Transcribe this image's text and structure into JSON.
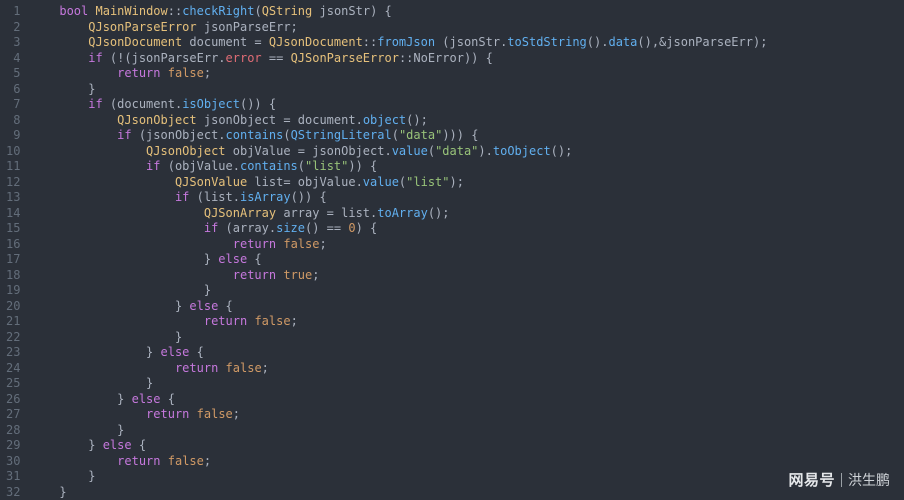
{
  "editor": {
    "line_count": 32,
    "language": "cpp"
  },
  "watermark": {
    "brand": "网易号",
    "author": "洪生鹏"
  },
  "chart_data": null,
  "code": {
    "lines": [
      {
        "tokens": [
          [
            "plain",
            "    "
          ],
          [
            "kw",
            "bool"
          ],
          [
            "plain",
            " "
          ],
          [
            "cls",
            "MainWindow"
          ],
          [
            "plain",
            "::"
          ],
          [
            "fn",
            "checkRight"
          ],
          [
            "plain",
            "("
          ],
          [
            "cls",
            "QString"
          ],
          [
            "plain",
            " jsonStr) {"
          ]
        ]
      },
      {
        "tokens": [
          [
            "plain",
            "        "
          ],
          [
            "cls",
            "QJsonParseError"
          ],
          [
            "plain",
            " jsonParseErr;"
          ]
        ]
      },
      {
        "tokens": [
          [
            "plain",
            "        "
          ],
          [
            "cls",
            "QJsonDocument"
          ],
          [
            "plain",
            " document = "
          ],
          [
            "cls",
            "QJsonDocument"
          ],
          [
            "plain",
            "::"
          ],
          [
            "fn",
            "fromJson"
          ],
          [
            "plain",
            " (jsonStr."
          ],
          [
            "fn",
            "toStdString"
          ],
          [
            "plain",
            "()."
          ],
          [
            "fn",
            "data"
          ],
          [
            "plain",
            "(),&jsonParseErr);"
          ]
        ]
      },
      {
        "tokens": [
          [
            "plain",
            "        "
          ],
          [
            "kw",
            "if"
          ],
          [
            "plain",
            " (!(jsonParseErr."
          ],
          [
            "id",
            "error"
          ],
          [
            "plain",
            " == "
          ],
          [
            "cls",
            "QJSonParseError"
          ],
          [
            "plain",
            "::NoError)) {"
          ]
        ]
      },
      {
        "tokens": [
          [
            "plain",
            "            "
          ],
          [
            "kw",
            "return"
          ],
          [
            "plain",
            " "
          ],
          [
            "lit",
            "false"
          ],
          [
            "plain",
            ";"
          ]
        ]
      },
      {
        "tokens": [
          [
            "plain",
            "        }"
          ]
        ]
      },
      {
        "tokens": [
          [
            "plain",
            "        "
          ],
          [
            "kw",
            "if"
          ],
          [
            "plain",
            " (document."
          ],
          [
            "fn",
            "isObject"
          ],
          [
            "plain",
            "()) {"
          ]
        ]
      },
      {
        "tokens": [
          [
            "plain",
            "            "
          ],
          [
            "cls",
            "QJsonObject"
          ],
          [
            "plain",
            " jsonObject = document."
          ],
          [
            "fn",
            "object"
          ],
          [
            "plain",
            "();"
          ]
        ]
      },
      {
        "tokens": [
          [
            "plain",
            "            "
          ],
          [
            "kw",
            "if"
          ],
          [
            "plain",
            " (jsonObject."
          ],
          [
            "fn",
            "contains"
          ],
          [
            "plain",
            "("
          ],
          [
            "fn",
            "QStringLiteral"
          ],
          [
            "plain",
            "("
          ],
          [
            "str",
            "\"data\""
          ],
          [
            "plain",
            "))) {"
          ]
        ]
      },
      {
        "tokens": [
          [
            "plain",
            "                "
          ],
          [
            "cls",
            "QJsonObject"
          ],
          [
            "plain",
            " objValue = jsonObject."
          ],
          [
            "fn",
            "value"
          ],
          [
            "plain",
            "("
          ],
          [
            "str",
            "\"data\""
          ],
          [
            "plain",
            ")."
          ],
          [
            "fn",
            "toObject"
          ],
          [
            "plain",
            "();"
          ]
        ]
      },
      {
        "tokens": [
          [
            "plain",
            "                "
          ],
          [
            "kw",
            "if"
          ],
          [
            "plain",
            " (objValue."
          ],
          [
            "fn",
            "contains"
          ],
          [
            "plain",
            "("
          ],
          [
            "str",
            "\"list\""
          ],
          [
            "plain",
            ")) {"
          ]
        ]
      },
      {
        "tokens": [
          [
            "plain",
            "                    "
          ],
          [
            "cls",
            "QJSonValue"
          ],
          [
            "plain",
            " list= objValue."
          ],
          [
            "fn",
            "value"
          ],
          [
            "plain",
            "("
          ],
          [
            "str",
            "\"list\""
          ],
          [
            "plain",
            ");"
          ]
        ]
      },
      {
        "tokens": [
          [
            "plain",
            "                    "
          ],
          [
            "kw",
            "if"
          ],
          [
            "plain",
            " (list."
          ],
          [
            "fn",
            "isArray"
          ],
          [
            "plain",
            "()) {"
          ]
        ]
      },
      {
        "tokens": [
          [
            "plain",
            "                        "
          ],
          [
            "cls",
            "QJSonArray"
          ],
          [
            "plain",
            " array = list."
          ],
          [
            "fn",
            "toArray"
          ],
          [
            "plain",
            "();"
          ]
        ]
      },
      {
        "tokens": [
          [
            "plain",
            "                        "
          ],
          [
            "kw",
            "if"
          ],
          [
            "plain",
            " (array."
          ],
          [
            "fn",
            "size"
          ],
          [
            "plain",
            "() == "
          ],
          [
            "num",
            "0"
          ],
          [
            "plain",
            ") {"
          ]
        ]
      },
      {
        "tokens": [
          [
            "plain",
            "                            "
          ],
          [
            "kw",
            "return"
          ],
          [
            "plain",
            " "
          ],
          [
            "lit",
            "false"
          ],
          [
            "plain",
            ";"
          ]
        ]
      },
      {
        "tokens": [
          [
            "plain",
            "                        } "
          ],
          [
            "kw",
            "else"
          ],
          [
            "plain",
            " {"
          ]
        ]
      },
      {
        "tokens": [
          [
            "plain",
            "                            "
          ],
          [
            "kw",
            "return"
          ],
          [
            "plain",
            " "
          ],
          [
            "lit",
            "true"
          ],
          [
            "plain",
            ";"
          ]
        ]
      },
      {
        "tokens": [
          [
            "plain",
            "                        }"
          ]
        ]
      },
      {
        "tokens": [
          [
            "plain",
            "                    } "
          ],
          [
            "kw",
            "else"
          ],
          [
            "plain",
            " {"
          ]
        ]
      },
      {
        "tokens": [
          [
            "plain",
            "                        "
          ],
          [
            "kw",
            "return"
          ],
          [
            "plain",
            " "
          ],
          [
            "lit",
            "false"
          ],
          [
            "plain",
            ";"
          ]
        ]
      },
      {
        "tokens": [
          [
            "plain",
            "                    }"
          ]
        ]
      },
      {
        "tokens": [
          [
            "plain",
            "                } "
          ],
          [
            "kw",
            "else"
          ],
          [
            "plain",
            " {"
          ]
        ]
      },
      {
        "tokens": [
          [
            "plain",
            "                    "
          ],
          [
            "kw",
            "return"
          ],
          [
            "plain",
            " "
          ],
          [
            "lit",
            "false"
          ],
          [
            "plain",
            ";"
          ]
        ]
      },
      {
        "tokens": [
          [
            "plain",
            "                }"
          ]
        ]
      },
      {
        "tokens": [
          [
            "plain",
            "            } "
          ],
          [
            "kw",
            "else"
          ],
          [
            "plain",
            " {"
          ]
        ]
      },
      {
        "tokens": [
          [
            "plain",
            "                "
          ],
          [
            "kw",
            "return"
          ],
          [
            "plain",
            " "
          ],
          [
            "lit",
            "false"
          ],
          [
            "plain",
            ";"
          ]
        ]
      },
      {
        "tokens": [
          [
            "plain",
            "            }"
          ]
        ]
      },
      {
        "tokens": [
          [
            "plain",
            "        } "
          ],
          [
            "kw",
            "else"
          ],
          [
            "plain",
            " {"
          ]
        ]
      },
      {
        "tokens": [
          [
            "plain",
            "            "
          ],
          [
            "kw",
            "return"
          ],
          [
            "plain",
            " "
          ],
          [
            "lit",
            "false"
          ],
          [
            "plain",
            ";"
          ]
        ]
      },
      {
        "tokens": [
          [
            "plain",
            "        }"
          ]
        ]
      },
      {
        "tokens": [
          [
            "plain",
            "    }"
          ]
        ]
      }
    ]
  }
}
